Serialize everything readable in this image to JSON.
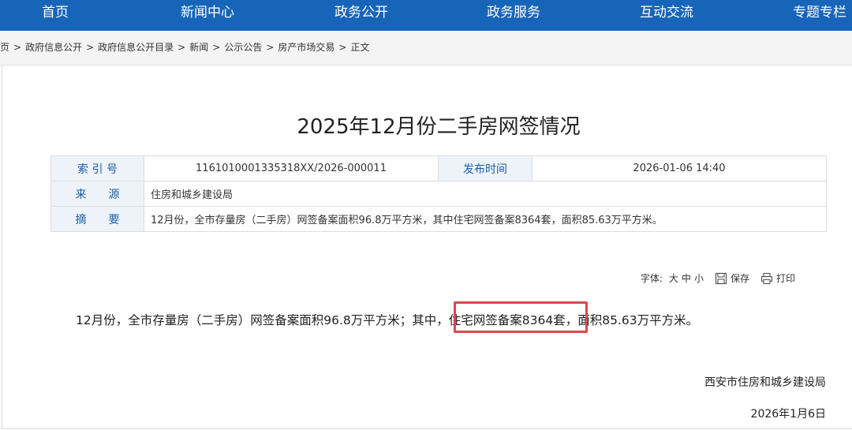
{
  "nav": {
    "items": [
      "首页",
      "新闻中心",
      "政务公开",
      "政务服务",
      "互动交流",
      "专题专栏"
    ]
  },
  "breadcrumb": {
    "items": [
      "首页",
      "政府信息公开",
      "政府信息公开目录",
      "新闻",
      "公示公告",
      "房产市场交易",
      "正文"
    ],
    "separator": ">"
  },
  "article": {
    "title": "2025年12月份二手房网签情况",
    "body_before": "12月份，全市存量房（二手房）网签备案面积96.8万平方米；其中，",
    "body_highlight": "住宅网签备案8364套，",
    "body_after": "面积85.63万平方米。",
    "signature": "西安市住房和城乡建设局",
    "date": "2026年1月6日"
  },
  "meta": {
    "index_label": "索 引 号",
    "index_value": "1161010001335318XX/2026-000011",
    "publish_label": "发布时间",
    "publish_value": "2026-01-06 14:40",
    "source_label": "来　　源",
    "source_value": "住房和城乡建设局",
    "summary_label": "摘　　要",
    "summary_value": "12月份，全市存量房（二手房）网签备案面积96.8万平方米，其中住宅网签备案8364套，面积85.63万平方米。"
  },
  "tools": {
    "font_label": "字体:",
    "size_large": "大",
    "size_medium": "中",
    "size_small": "小",
    "save": "保存",
    "print": "打印"
  },
  "colors": {
    "nav_bg": "#1765b9",
    "label_text": "#1a5fa8",
    "highlight_border": "#e0464b"
  }
}
